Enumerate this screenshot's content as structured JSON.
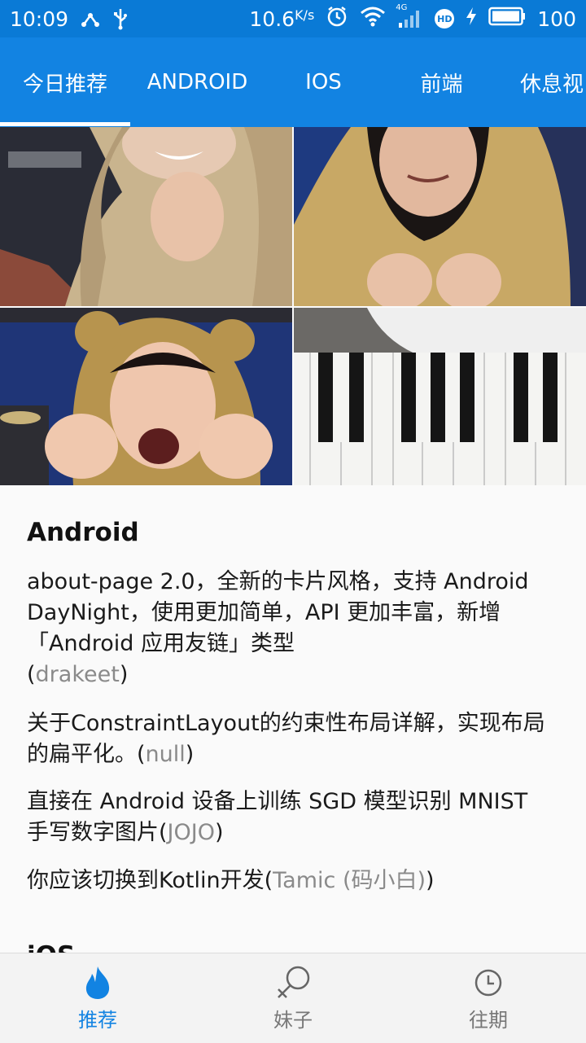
{
  "status_bar": {
    "time": "10:09",
    "network_speed": "10.6",
    "network_speed_unit": "K/s",
    "signal_type": "4G",
    "hd_badge": "HD",
    "battery_level": "100"
  },
  "tabs": [
    {
      "label": "今日推荐",
      "active": true
    },
    {
      "label": "ANDROID"
    },
    {
      "label": "IOS"
    },
    {
      "label": "前端"
    },
    {
      "label": "休息视"
    }
  ],
  "sections": [
    {
      "title": "Android",
      "entries": [
        {
          "text": "about-page 2.0，全新的卡片风格，支持 Android DayNight，使用更加简单，API 更加丰富，新增「Android 应用友链」类型",
          "author": "drakeet"
        },
        {
          "text": "关于ConstraintLayout的约束性布局详解，实现布局的扁平化。",
          "author": "null"
        },
        {
          "text": "直接在 Android 设备上训练 SGD 模型识别 MNIST 手写数字图片",
          "author": "JOJO"
        },
        {
          "text": "你应该切换到Kotlin开发",
          "author": "Tamic (码小白)"
        }
      ]
    },
    {
      "title": "iOS"
    }
  ],
  "bottom_nav": [
    {
      "label": "推荐",
      "icon": "flame-icon",
      "active": true
    },
    {
      "label": "妹子",
      "icon": "female-symbol-icon"
    },
    {
      "label": "往期",
      "icon": "clock-icon"
    }
  ],
  "colors": {
    "primary": "#1283e2",
    "status_bar": "#0a7ad6",
    "author_gray": "#8a8a8a"
  }
}
